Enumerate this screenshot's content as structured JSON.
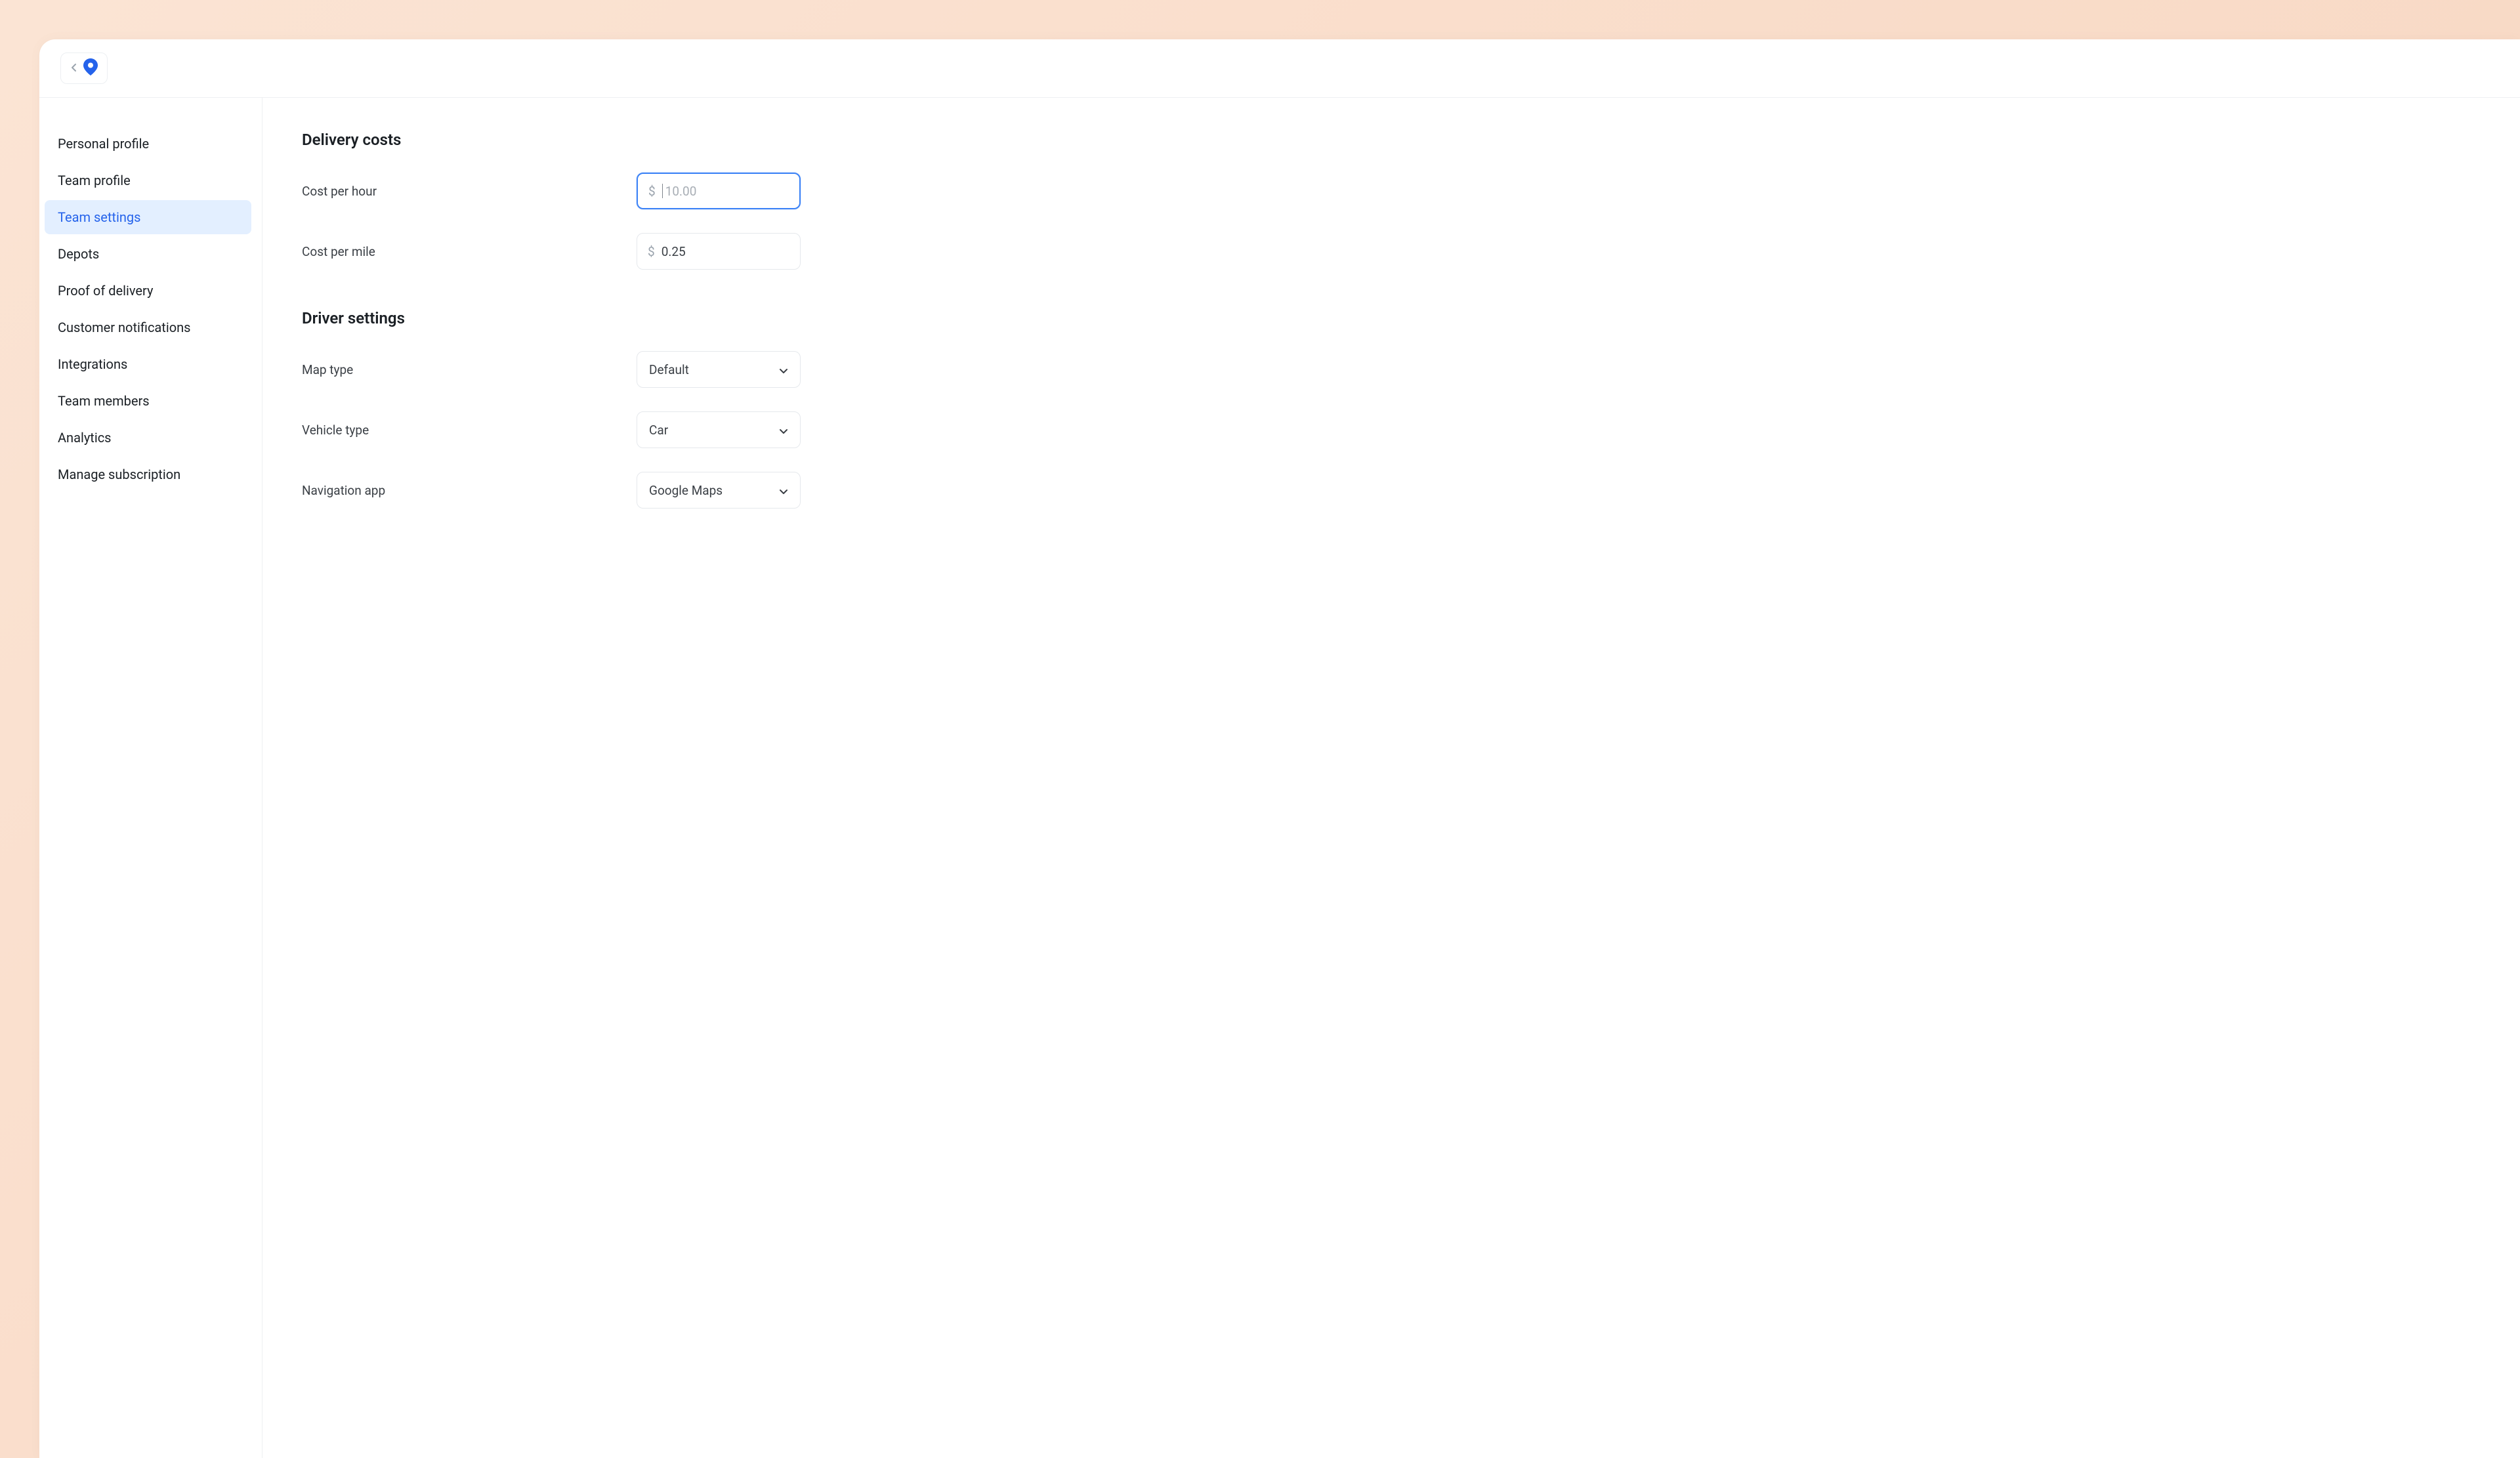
{
  "sidebar": {
    "items": [
      {
        "label": "Personal profile",
        "active": false
      },
      {
        "label": "Team profile",
        "active": false
      },
      {
        "label": "Team settings",
        "active": true
      },
      {
        "label": "Depots",
        "active": false
      },
      {
        "label": "Proof of delivery",
        "active": false
      },
      {
        "label": "Customer notifications",
        "active": false
      },
      {
        "label": "Integrations",
        "active": false
      },
      {
        "label": "Team members",
        "active": false
      },
      {
        "label": "Analytics",
        "active": false
      },
      {
        "label": "Manage subscription",
        "active": false
      }
    ]
  },
  "sections": {
    "delivery_costs": {
      "title": "Delivery costs",
      "cost_per_hour": {
        "label": "Cost per hour",
        "currency": "$",
        "placeholder": "10.00"
      },
      "cost_per_mile": {
        "label": "Cost per mile",
        "currency": "$",
        "value": "0.25"
      }
    },
    "driver_settings": {
      "title": "Driver settings",
      "map_type": {
        "label": "Map type",
        "value": "Default"
      },
      "vehicle_type": {
        "label": "Vehicle type",
        "value": "Car"
      },
      "navigation_app": {
        "label": "Navigation app",
        "value": "Google Maps"
      }
    }
  }
}
